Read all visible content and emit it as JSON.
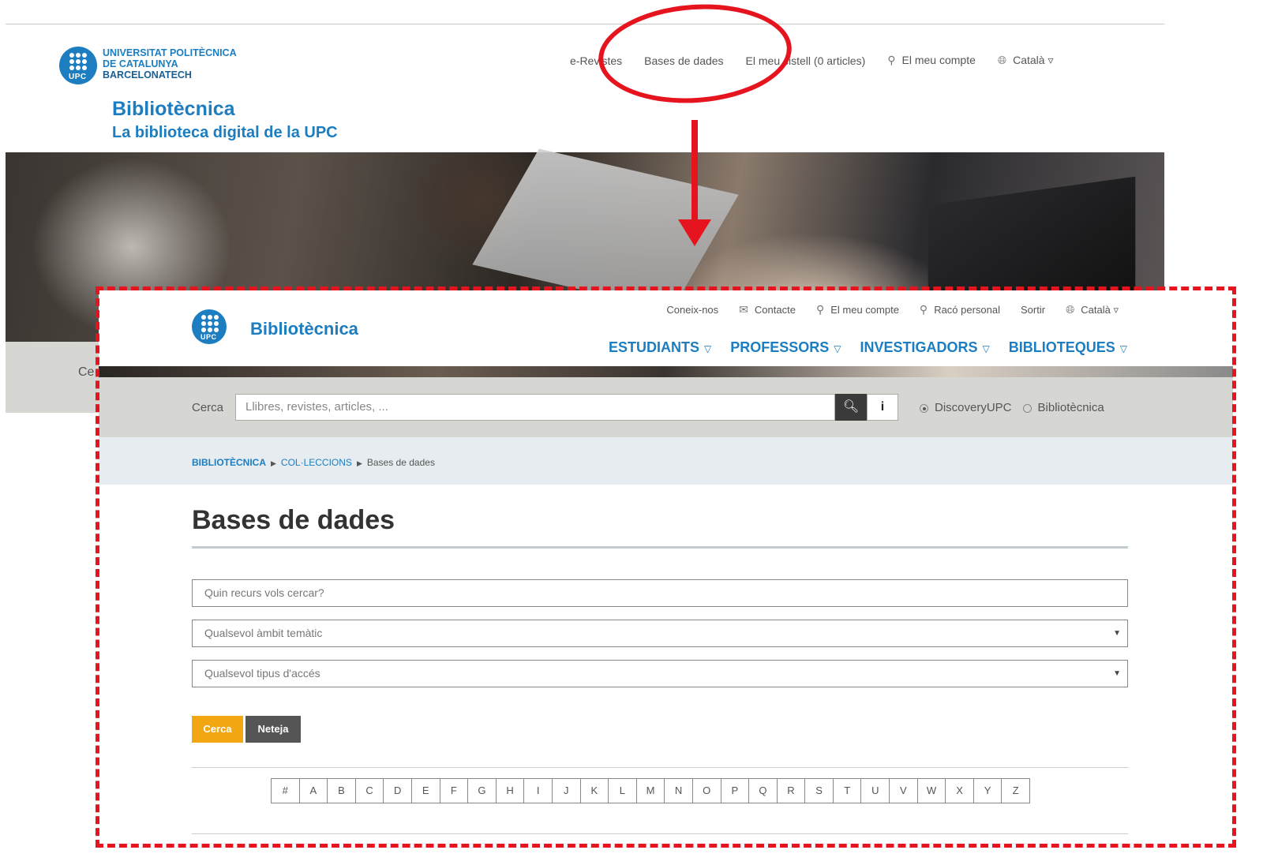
{
  "back_page": {
    "university_lines": [
      "UNIVERSITAT POLITÈCNICA",
      "DE CATALUNYA",
      "BARCELONATECH"
    ],
    "logo_text": "UPC",
    "title": "Bibliotècnica",
    "subtitle": "La biblioteca digital de la UPC",
    "nav": [
      "e-Revistes",
      "Bases de dades",
      "El meu cistell (0 articles)",
      "El meu compte",
      "Català ▿"
    ],
    "search_label": "Ce"
  },
  "front_page": {
    "logo_text": "UPC",
    "brand": "Bibliotècnica",
    "top_nav": [
      "Coneix-nos",
      "Contacte",
      "El meu compte",
      "Racó personal",
      "Sortir",
      "Català ▿"
    ],
    "main_nav": [
      "ESTUDIANTS",
      "PROFESSORS",
      "INVESTIGADORS",
      "BIBLIOTEQUES"
    ],
    "search": {
      "label": "Cerca",
      "placeholder": "Llibres, revistes, articles, ...",
      "options": [
        "DiscoveryUPC",
        "Bibliotècnica"
      ]
    },
    "breadcrumb": [
      "BIBLIOTÈCNICA",
      "COL·LECCIONS",
      "Bases de dades"
    ],
    "heading": "Bases de dades",
    "filters": {
      "resource_placeholder": "Quin recurs vols cercar?",
      "subject": "Qualsevol àmbit temàtic",
      "access": "Qualsevol tipus d'accés"
    },
    "buttons": {
      "search": "Cerca",
      "clear": "Neteja"
    },
    "alphabet": [
      "#",
      "A",
      "B",
      "C",
      "D",
      "E",
      "F",
      "G",
      "H",
      "I",
      "J",
      "K",
      "L",
      "M",
      "N",
      "O",
      "P",
      "Q",
      "R",
      "S",
      "T",
      "U",
      "V",
      "W",
      "X",
      "Y",
      "Z"
    ]
  },
  "annotation_color": "#e5141e",
  "brand_color": "#1c7dc0"
}
